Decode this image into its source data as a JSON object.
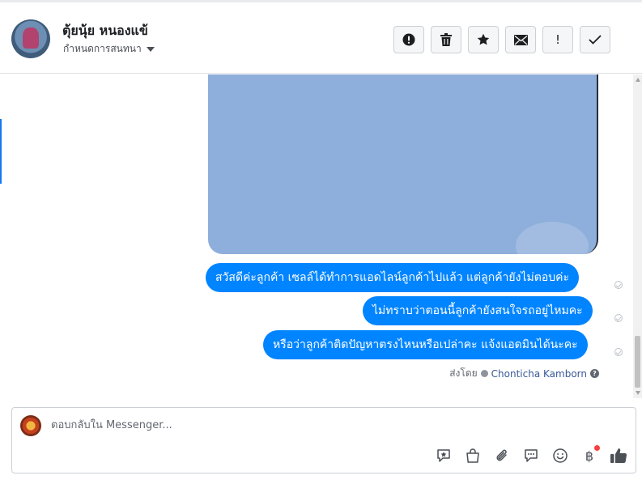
{
  "header": {
    "contact_name": "ตุ้ยนุ้ย หนองแข้",
    "assign_label": "กำหนดการสนทนา",
    "actions": [
      {
        "icon": "alert-circle-icon"
      },
      {
        "icon": "trash-icon"
      },
      {
        "icon": "star-icon"
      },
      {
        "icon": "envelope-icon"
      },
      {
        "icon": "exclamation-icon",
        "glyph": "!"
      },
      {
        "icon": "check-icon"
      }
    ]
  },
  "messages": [
    {
      "text": "สวัสดีค่ะลูกค้า เซลล์ได้ทำการแอดไลน์ลูกค้าไปแล้ว แต่ลูกค้ายังไม่ตอบค่ะ"
    },
    {
      "text": "ไม่ทราบว่าตอนนี้ลูกค้ายังสนใจรถอยู่ไหมคะ"
    },
    {
      "text": "หรือว่าลูกค้าติดปัญหาตรงไหนหรือเปล่าคะ แจ้งแอดมินได้นะคะ"
    }
  ],
  "sent_by": {
    "label": "ส่งโดย",
    "name": "Chonticha Kamborn",
    "help_glyph": "?"
  },
  "composer": {
    "placeholder": "ตอบกลับใน Messenger...",
    "tools": [
      "saved-reply-icon",
      "shopping-bag-icon",
      "paperclip-icon",
      "chat-bubble-icon",
      "smiley-icon",
      "baht-icon",
      "thumbs-up-icon"
    ],
    "baht_glyph": "฿"
  },
  "colors": {
    "bubble": "#0084ff",
    "accent": "#1877f2",
    "notification": "#fa3e3e"
  }
}
